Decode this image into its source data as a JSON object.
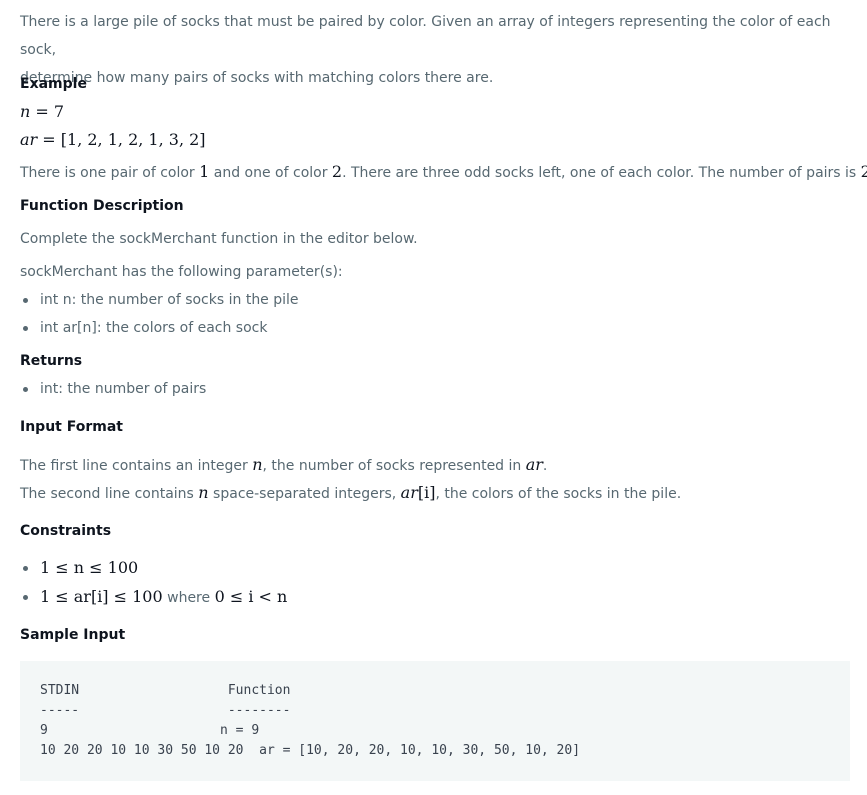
{
  "intro": {
    "line1": "There is a large pile of socks that must be paired by color. Given an array of integers representing the color of each sock,",
    "line2": "determine how many pairs of socks with matching colors there are."
  },
  "example": {
    "heading": "Example",
    "n_lhs": "n",
    "n_rhs": " = 7",
    "ar_lhs": "ar",
    "ar_rhs": " = [1, 2, 1, 2, 1, 3, 2]",
    "explain_a": "There is one pair of color ",
    "explain_v1": "1",
    "explain_b": " and one of color ",
    "explain_v2": "2",
    "explain_c": ". There are three odd socks left, one of each color. The number of pairs is ",
    "explain_v3": "2",
    "explain_d": "."
  },
  "function_description": {
    "heading": "Function Description",
    "text1": "Complete the sockMerchant function in the editor below.",
    "text2": "sockMerchant has the following parameter(s):",
    "params": [
      "int n: the number of socks in the pile",
      "int ar[n]: the colors of each sock"
    ]
  },
  "returns": {
    "heading": "Returns",
    "items": [
      "int: the number of pairs"
    ]
  },
  "input_format": {
    "heading": "Input Format",
    "line1_a": "The first line contains an integer ",
    "line1_n": "n",
    "line1_b": ", the number of socks represented in ",
    "line1_ar": "ar",
    "line1_c": ".",
    "line2_a": "The second line contains ",
    "line2_n": "n",
    "line2_b": " space-separated integers, ",
    "line2_ar": "ar",
    "line2_i": "[i]",
    "line2_c": ", the colors of the socks in the pile."
  },
  "constraints": {
    "heading": "Constraints",
    "c1": "1 ≤ n ≤ 100",
    "c2_math": "1 ≤ ar[i] ≤ 100",
    "c2_where": " where ",
    "c2_math2": "0 ≤ i < n"
  },
  "sample_input": {
    "heading": "Sample Input",
    "code": "STDIN                   Function\n-----                   --------\n9                      n = 9\n10 20 20 10 10 30 50 10 20  ar = [10, 20, 20, 10, 10, 30, 50, 10, 20]"
  }
}
